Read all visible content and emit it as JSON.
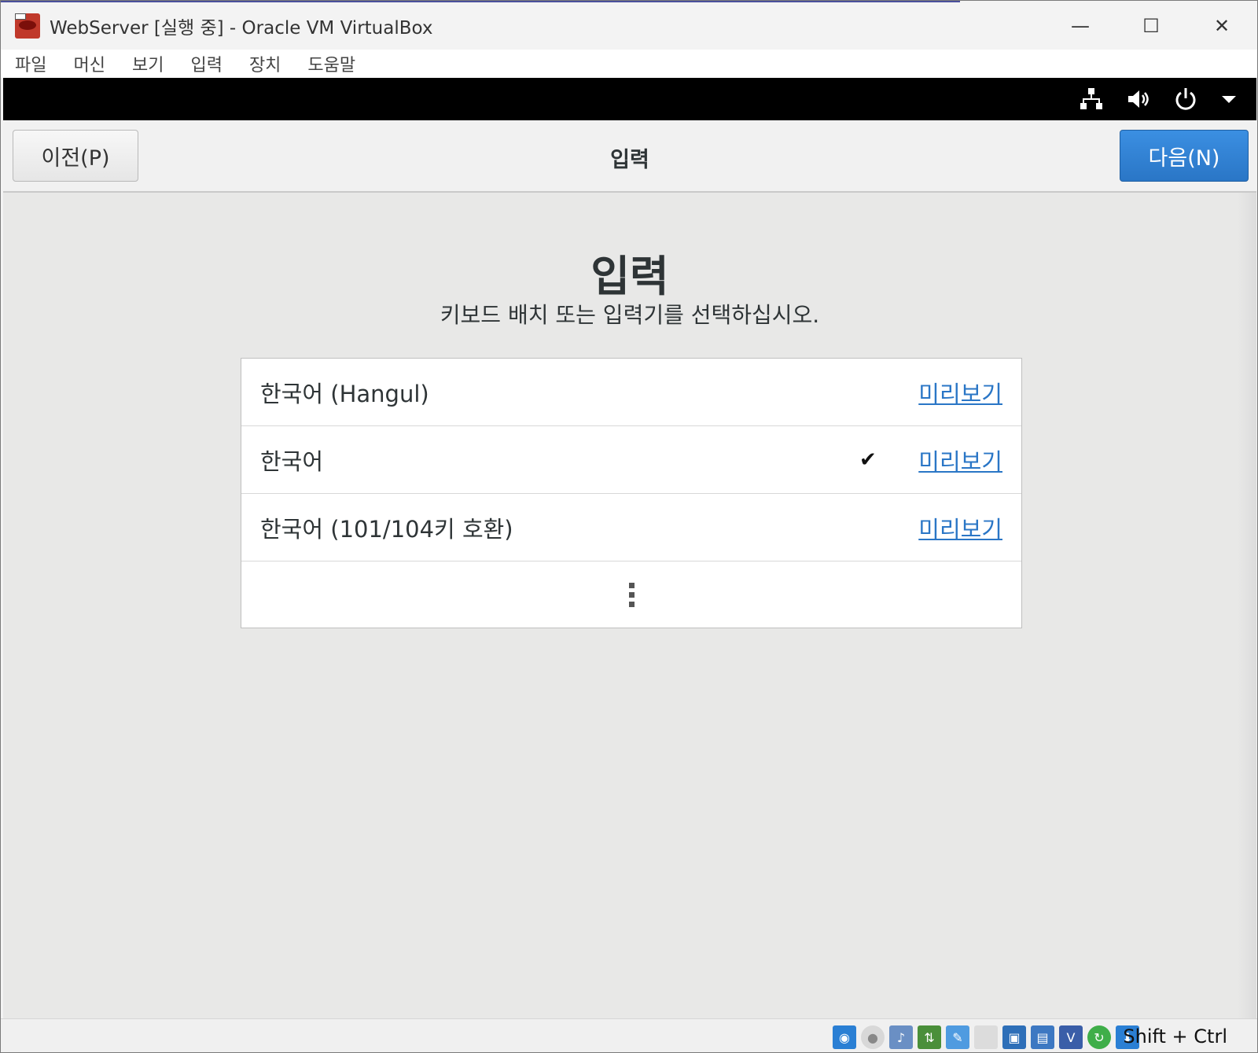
{
  "window": {
    "title": "WebServer [실행 중] - Oracle VM VirtualBox"
  },
  "menubar": {
    "items": [
      "파일",
      "머신",
      "보기",
      "입력",
      "장치",
      "도움말"
    ]
  },
  "window_controls": {
    "minimize": "—",
    "maximize": "☐",
    "close": "✕"
  },
  "tray": {
    "network_icon": "network-icon",
    "volume_icon": "volume-icon",
    "power_icon": "power-icon",
    "dropdown_icon": "chevron-down-icon"
  },
  "header": {
    "prev_label": "이전(P)",
    "title": "입력",
    "next_label": "다음(N)"
  },
  "main": {
    "title": "입력",
    "subtitle": "키보드 배치 또는 입력기를 선택하십시오."
  },
  "layouts": [
    {
      "label": "한국어 (Hangul)",
      "preview": "미리보기",
      "selected": false
    },
    {
      "label": "한국어",
      "preview": "미리보기",
      "selected": true
    },
    {
      "label": "한국어 (101/104키 호환)",
      "preview": "미리보기",
      "selected": false
    }
  ],
  "statusbar": {
    "host_key": "Shift + Ctrl"
  },
  "colors": {
    "accent": "#2a76c6",
    "link": "#2a76c6",
    "guest_topbar": "#000000"
  }
}
